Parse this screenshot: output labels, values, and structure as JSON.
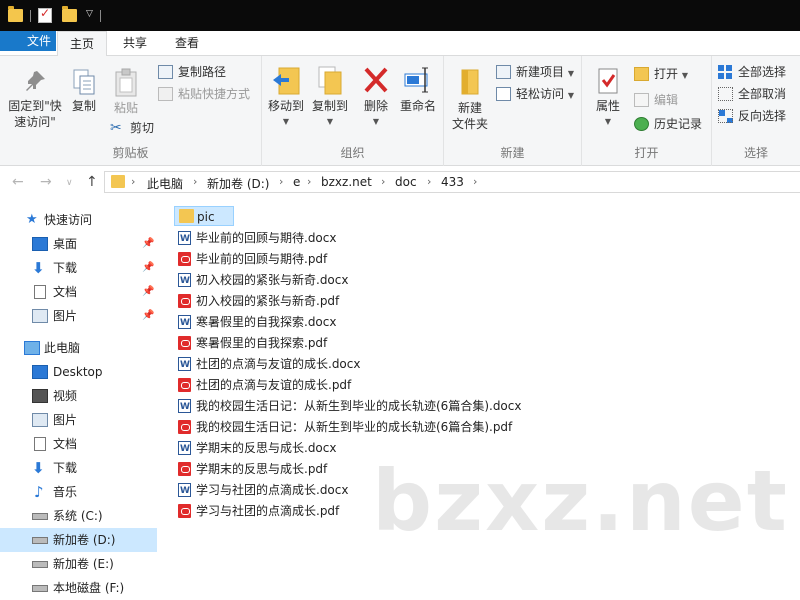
{
  "quick_access_toolbar": {
    "icons": [
      "folder-icon",
      "properties-icon",
      "new-folder-icon",
      "customize-arrow-icon"
    ]
  },
  "tabs": [
    {
      "label": "文件"
    },
    {
      "label": "主页"
    },
    {
      "label": "共享"
    },
    {
      "label": "查看"
    }
  ],
  "ribbon": {
    "clipboard": {
      "label": "剪贴板",
      "pin_label_line1": "固定到\"快",
      "pin_label_line2": "速访问\"",
      "copy_label": "复制",
      "paste_label": "粘贴",
      "copy_path": "复制路径",
      "paste_shortcut": "粘贴快捷方式",
      "cut": "剪切"
    },
    "organize": {
      "label": "组织",
      "move_to": "移动到",
      "copy_to": "复制到",
      "delete": "删除",
      "rename": "重命名"
    },
    "new": {
      "label": "新建",
      "new_folder_line1": "新建",
      "new_folder_line2": "文件夹",
      "new_item": "新建项目",
      "easy_access": "轻松访问"
    },
    "open": {
      "label": "打开",
      "properties": "属性",
      "open": "打开",
      "edit": "编辑",
      "history": "历史记录"
    },
    "select": {
      "label": "选择",
      "select_all": "全部选择",
      "select_none": "全部取消",
      "invert": "反向选择"
    }
  },
  "address": {
    "crumbs": [
      "此电脑",
      "新加卷 (D:)",
      "e",
      "bzxz.net",
      "doc",
      "433"
    ]
  },
  "sidebar": {
    "items": [
      {
        "label": "快速访问",
        "icon": "star-icon",
        "pinned": false,
        "selected": false
      },
      {
        "label": "桌面",
        "icon": "desktop-icon",
        "pinned": true,
        "selected": false
      },
      {
        "label": "下载",
        "icon": "download-icon",
        "pinned": true,
        "selected": false
      },
      {
        "label": "文档",
        "icon": "document-icon",
        "pinned": true,
        "selected": false
      },
      {
        "label": "图片",
        "icon": "pictures-icon",
        "pinned": true,
        "selected": false
      },
      {
        "label": "此电脑",
        "icon": "computer-icon",
        "pinned": false,
        "selected": false
      },
      {
        "label": "Desktop",
        "icon": "desktop-icon",
        "pinned": false,
        "selected": false
      },
      {
        "label": "视频",
        "icon": "videos-icon",
        "pinned": false,
        "selected": false
      },
      {
        "label": "图片",
        "icon": "pictures-icon",
        "pinned": false,
        "selected": false
      },
      {
        "label": "文档",
        "icon": "document-icon",
        "pinned": false,
        "selected": false
      },
      {
        "label": "下载",
        "icon": "download-icon",
        "pinned": false,
        "selected": false
      },
      {
        "label": "音乐",
        "icon": "music-icon",
        "pinned": false,
        "selected": false
      },
      {
        "label": "系统 (C:)",
        "icon": "windows-drive-icon",
        "pinned": false,
        "selected": false
      },
      {
        "label": "新加卷 (D:)",
        "icon": "drive-icon",
        "pinned": false,
        "selected": true
      },
      {
        "label": "新加卷 (E:)",
        "icon": "drive-icon",
        "pinned": false,
        "selected": false
      },
      {
        "label": "本地磁盘 (F:)",
        "icon": "drive-icon",
        "pinned": false,
        "selected": false
      }
    ]
  },
  "files": [
    {
      "name": "pic",
      "type": "folder",
      "selected": true
    },
    {
      "name": "毕业前的回顾与期待.docx",
      "type": "docx",
      "selected": false
    },
    {
      "name": "毕业前的回顾与期待.pdf",
      "type": "pdf",
      "selected": false
    },
    {
      "name": "初入校园的紧张与新奇.docx",
      "type": "docx",
      "selected": false
    },
    {
      "name": "初入校园的紧张与新奇.pdf",
      "type": "pdf",
      "selected": false
    },
    {
      "name": "寒暑假里的自我探索.docx",
      "type": "docx",
      "selected": false
    },
    {
      "name": "寒暑假里的自我探索.pdf",
      "type": "pdf",
      "selected": false
    },
    {
      "name": "社团的点滴与友谊的成长.docx",
      "type": "docx",
      "selected": false
    },
    {
      "name": "社团的点滴与友谊的成长.pdf",
      "type": "pdf",
      "selected": false
    },
    {
      "name": "我的校园生活日记：从新生到毕业的成长轨迹(6篇合集).docx",
      "type": "docx",
      "selected": false
    },
    {
      "name": "我的校园生活日记：从新生到毕业的成长轨迹(6篇合集).pdf",
      "type": "pdf",
      "selected": false
    },
    {
      "name": "学期末的反思与成长.docx",
      "type": "docx",
      "selected": false
    },
    {
      "name": "学期末的反思与成长.pdf",
      "type": "pdf",
      "selected": false
    },
    {
      "name": "学习与社团的点滴成长.docx",
      "type": "docx",
      "selected": false
    },
    {
      "name": "学习与社团的点滴成长.pdf",
      "type": "pdf",
      "selected": false
    }
  ],
  "watermark": "bzxz.net",
  "colors": {
    "file_tab": "#1979ca",
    "selection": "#cce8ff",
    "ribbon_bg": "#f5f6f7",
    "folder": "#f3c652",
    "pdf": "#e02b2b",
    "delete_red": "#d42a2a"
  }
}
